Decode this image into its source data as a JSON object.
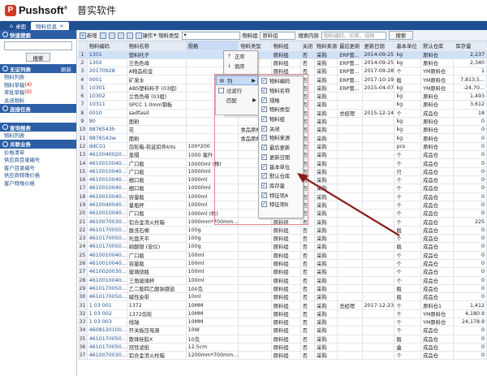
{
  "app": {
    "brand": "Pushsoft",
    "brand_cn": "普实软件",
    "reg": "®"
  },
  "tabs": [
    {
      "label": "桌面"
    },
    {
      "label": "物料信息"
    }
  ],
  "sidebar": {
    "search_header": "快速搜索",
    "search_button": "搜索",
    "filter_header": "无证列表",
    "filter_action": "刷新",
    "filter_items": [
      {
        "label": "物料列表",
        "count": ""
      },
      {
        "label": "物料草稿",
        "count": "(4)"
      },
      {
        "label": "草批草稿",
        "count": "(0)"
      },
      {
        "label": "关闭物料",
        "count": ""
      }
    ],
    "link_header": "连接任务",
    "query_header": "查询报表",
    "query_items": [
      {
        "label": "物料列表"
      }
    ],
    "rel_header": "关联业务",
    "rel_items": [
      {
        "label": "价格清单"
      },
      {
        "label": "供应商目录编号"
      },
      {
        "label": "客户目录编号"
      },
      {
        "label": "供应商特殊价格"
      },
      {
        "label": "客户特殊价格"
      }
    ]
  },
  "toolbar": {
    "new_label": "新增",
    "ops_label": "操作",
    "type_label": "物料类型",
    "group_label": "物料组",
    "group_value": "原料组",
    "content_label": "搜索内容",
    "content_placeholder": "物料编码、名称、规格",
    "search_button": "搜索"
  },
  "table": {
    "columns": [
      "物料编码",
      "物料名称",
      "规格",
      "物料类型",
      "物料组",
      "关闭",
      "物料来源",
      "最后更新",
      "更新日期",
      "基本单位",
      "默认仓库",
      "库存量"
    ],
    "rows": [
      {
        "n": "1",
        "c": "1301",
        "name": "塑料托子",
        "spec": "",
        "type": "",
        "grp": "原料组",
        "close": "否",
        "src": "采购",
        "upd": "ERP管...",
        "date": "2014-09-25",
        "unit": "kg",
        "wh": "原料仓",
        "qty": "2,237"
      },
      {
        "n": "2",
        "c": "1302",
        "name": "兰色色母",
        "spec": "",
        "type": "",
        "grp": "原料组",
        "close": "否",
        "src": "采购",
        "upd": "ERP管...",
        "date": "2014-09-25",
        "unit": "kg",
        "wh": "原料仓",
        "qty": "2,340"
      },
      {
        "n": "3",
        "c": "20170928",
        "name": "A物品校金",
        "spec": "",
        "type": "",
        "grp": "原料组",
        "close": "否",
        "src": "采购",
        "upd": "ERP管...",
        "date": "2017-09-28",
        "unit": "个",
        "wh": "YM原料仓",
        "qty": "1"
      },
      {
        "n": "4",
        "c": "0001",
        "name": "矿泉水",
        "spec": "",
        "type": "",
        "grp": "原料组",
        "close": "否",
        "src": "采购",
        "upd": "ERP管...",
        "date": "2017-10-19",
        "unit": "瓶",
        "wh": "YM原料仓",
        "qty": "7,813,5..."
      },
      {
        "n": "5",
        "c": "10301",
        "name": "ABS塑料料子 (03组)",
        "spec": "",
        "type": "",
        "grp": "原料组",
        "close": "否",
        "src": "采购",
        "upd": "ERP管...",
        "date": "2015-04-07",
        "unit": "kg",
        "wh": "YM原料仓",
        "qty": "-24,70..."
      },
      {
        "n": "6",
        "c": "10302",
        "name": "兰色色母 (03组)",
        "spec": "",
        "type": "",
        "grp": "原料组",
        "close": "否",
        "src": "采购",
        "upd": "",
        "date": "",
        "unit": "kg",
        "wh": "原料仓",
        "qty": "1,493"
      },
      {
        "n": "7",
        "c": "10311",
        "name": "SPCC 1.0mm钢板",
        "spec": "",
        "type": "",
        "grp": "原料组",
        "close": "否",
        "src": "采购",
        "upd": "",
        "date": "",
        "unit": "kg",
        "wh": "原料仓",
        "qty": "3,612"
      },
      {
        "n": "8",
        "c": "0010",
        "name": "sadfasd",
        "spec": "",
        "type": "",
        "grp": "原料组",
        "close": "否",
        "src": "采购",
        "upd": "总经理",
        "date": "2015-12-14",
        "unit": "个",
        "wh": "成品仓",
        "qty": "18"
      },
      {
        "n": "9",
        "c": "90",
        "name": "面粉",
        "spec": "",
        "type": "",
        "grp": "原料组",
        "close": "否",
        "src": "采购",
        "upd": "",
        "date": "",
        "unit": "kg",
        "wh": "原料仓",
        "qty": "0"
      },
      {
        "n": "10",
        "c": "9876543h",
        "name": "花",
        "spec": "",
        "type": "食品原材料",
        "grp": "原料组",
        "close": "否",
        "src": "采购",
        "upd": "",
        "date": "",
        "unit": "kg",
        "wh": "原料仓",
        "qty": "0"
      },
      {
        "n": "11",
        "c": "9876543w",
        "name": "面粉",
        "spec": "",
        "type": "食品原材料",
        "grp": "原料组",
        "close": "否",
        "src": "采购",
        "upd": "",
        "date": "",
        "unit": "kg",
        "wh": "原料仓",
        "qty": "0"
      },
      {
        "n": "12",
        "c": "ddC01",
        "name": "齿轮箱-轮延扣件kits",
        "spec": "100*200",
        "type": "",
        "grp": "原料组",
        "close": "否",
        "src": "采购",
        "upd": "",
        "date": "",
        "unit": "pcs",
        "wh": "原料仓",
        "qty": "0"
      },
      {
        "n": "13",
        "c": "4610040020...",
        "name": "盖帽",
        "spec": "1000 毫升",
        "type": "",
        "grp": "原料组",
        "close": "否",
        "src": "采购",
        "upd": "",
        "date": "",
        "unit": "个",
        "wh": "成品仓",
        "qty": "0"
      },
      {
        "n": "14",
        "c": "4610010040...",
        "name": "广口瓶",
        "spec": "10000ml (株)",
        "type": "",
        "grp": "原料组",
        "close": "否",
        "src": "采购",
        "upd": "",
        "date": "",
        "unit": "个",
        "wh": "成品仓",
        "qty": "0"
      },
      {
        "n": "15",
        "c": "4610010040...",
        "name": "广口瓶",
        "spec": "10000ml",
        "type": "",
        "grp": "原料组",
        "close": "否",
        "src": "采购",
        "upd": "",
        "date": "",
        "unit": "只",
        "wh": "成品仓",
        "qty": "0"
      },
      {
        "n": "16",
        "c": "4610010040...",
        "name": "细口瓶",
        "spec": "1000ml",
        "type": "",
        "grp": "原料组",
        "close": "否",
        "src": "采购",
        "upd": "",
        "date": "",
        "unit": "个",
        "wh": "成品仓",
        "qty": "0"
      },
      {
        "n": "17",
        "c": "4610010040...",
        "name": "细口瓶",
        "spec": "10000ml",
        "type": "",
        "grp": "原料组",
        "close": "否",
        "src": "采购",
        "upd": "",
        "date": "",
        "unit": "个",
        "wh": "成品仓",
        "qty": "0"
      },
      {
        "n": "18",
        "c": "4610010040...",
        "name": "容量瓶",
        "spec": "1000ml",
        "type": "",
        "grp": "原料组",
        "close": "否",
        "src": "采购",
        "upd": "",
        "date": "",
        "unit": "个",
        "wh": "成品仓",
        "qty": "0"
      },
      {
        "n": "19",
        "c": "4610040040...",
        "name": "量瓶杯",
        "spec": "1000ml",
        "type": "",
        "grp": "原料组",
        "close": "否",
        "src": "采购",
        "upd": "",
        "date": "",
        "unit": "个",
        "wh": "成品仓",
        "qty": "0"
      },
      {
        "n": "20",
        "c": "4610010040...",
        "name": "广口瓶",
        "spec": "1000ml (株)",
        "type": "",
        "grp": "原料组",
        "close": "否",
        "src": "采购",
        "upd": "",
        "date": "",
        "unit": "个",
        "wh": "成品仓",
        "qty": "0"
      },
      {
        "n": "21",
        "c": "4610070030...",
        "name": "铝合金消火栓箱",
        "spec": "1000mm*700mm...",
        "type": "",
        "grp": "原料组",
        "close": "否",
        "src": "采购",
        "upd": "",
        "date": "",
        "unit": "个",
        "wh": "成品仓",
        "qty": "225"
      },
      {
        "n": "22",
        "c": "4610170050...",
        "name": "酸洗石棉",
        "spec": "100g",
        "type": "",
        "grp": "原料组",
        "close": "否",
        "src": "采购",
        "upd": "",
        "date": "",
        "unit": "瓶",
        "wh": "成品仓",
        "qty": "0"
      },
      {
        "n": "23",
        "c": "4610170050...",
        "name": "托盘天平",
        "spec": "100g",
        "type": "",
        "grp": "原料组",
        "close": "否",
        "src": "采购",
        "upd": "",
        "date": "",
        "unit": "个",
        "wh": "成品仓",
        "qty": "0"
      },
      {
        "n": "24",
        "c": "4610170050...",
        "name": "硝酸银 (安仪)",
        "spec": "100g",
        "type": "",
        "grp": "原料组",
        "close": "否",
        "src": "采购",
        "upd": "",
        "date": "",
        "unit": "瓶",
        "wh": "成品仓",
        "qty": "0"
      },
      {
        "n": "25",
        "c": "4610010040...",
        "name": "广口瓶",
        "spec": "100ml",
        "type": "",
        "grp": "原料组",
        "close": "否",
        "src": "采购",
        "upd": "",
        "date": "",
        "unit": "个",
        "wh": "成品仓",
        "qty": "0"
      },
      {
        "n": "26",
        "c": "4610010040...",
        "name": "容量瓶",
        "spec": "100ml",
        "type": "",
        "grp": "原料组",
        "close": "否",
        "src": "采购",
        "upd": "",
        "date": "",
        "unit": "个",
        "wh": "成品仓",
        "qty": "0"
      },
      {
        "n": "27",
        "c": "4610020030...",
        "name": "玻璃烧瓶",
        "spec": "100ml",
        "type": "",
        "grp": "原料组",
        "close": "否",
        "src": "采购",
        "upd": "",
        "date": "",
        "unit": "个",
        "wh": "成品仓",
        "qty": "0"
      },
      {
        "n": "28",
        "c": "4610010040...",
        "name": "三角玻璃杯",
        "spec": "100ml",
        "type": "",
        "grp": "原料组",
        "close": "否",
        "src": "采购",
        "upd": "",
        "date": "",
        "unit": "个",
        "wh": "成品仓",
        "qty": "0"
      },
      {
        "n": "29",
        "c": "4610170050...",
        "name": "乙二胺四乙酸钠镁盐",
        "spec": "100克",
        "type": "",
        "grp": "原料组",
        "close": "否",
        "src": "采购",
        "upd": "",
        "date": "",
        "unit": "瓶",
        "wh": "成品仓",
        "qty": "0"
      },
      {
        "n": "30",
        "c": "4610170050...",
        "name": "碱性染带",
        "spec": "10ml",
        "type": "",
        "grp": "原料组",
        "close": "否",
        "src": "采购",
        "upd": "",
        "date": "",
        "unit": "瓶",
        "wh": "成品仓",
        "qty": "0"
      },
      {
        "n": "31",
        "c": "1 03 001",
        "name": "1372",
        "spec": "10MM",
        "type": "",
        "grp": "原料组",
        "close": "否",
        "src": "采购",
        "upd": "总经理",
        "date": "2017-12-23",
        "unit": "个",
        "wh": "原料仓1",
        "qty": "1,412"
      },
      {
        "n": "32",
        "c": "1 03 002",
        "name": "1372齿轮",
        "spec": "10MM",
        "type": "",
        "grp": "原料组",
        "close": "否",
        "src": "采购",
        "upd": "",
        "date": "",
        "unit": "个",
        "wh": "YM原料仓",
        "qty": "4,180.9"
      },
      {
        "n": "33",
        "c": "1 03 003",
        "name": "线轴",
        "spec": "10MM",
        "type": "",
        "grp": "原料组",
        "close": "否",
        "src": "采购",
        "upd": "",
        "date": "",
        "unit": "个",
        "wh": "YM原料仓",
        "qty": "24,178.9"
      },
      {
        "n": "34",
        "c": "4608120100...",
        "name": "开关板压电源",
        "spec": "10W",
        "type": "",
        "grp": "原料组",
        "close": "否",
        "src": "采购",
        "upd": "",
        "date": "",
        "unit": "个",
        "wh": "成品仓",
        "qty": "0"
      },
      {
        "n": "35",
        "c": "4610170050...",
        "name": "散珠硅胶X",
        "spec": "10克",
        "type": "",
        "grp": "原料组",
        "close": "否",
        "src": "采购",
        "upd": "",
        "date": "",
        "unit": "瓶",
        "wh": "成品仓",
        "qty": "0"
      },
      {
        "n": "36",
        "c": "4610170050...",
        "name": "冠性滤纸",
        "spec": "12.5cm",
        "type": "",
        "grp": "原料组",
        "close": "否",
        "src": "采购",
        "upd": "",
        "date": "",
        "unit": "盒",
        "wh": "成品仓",
        "qty": "0"
      },
      {
        "n": "37",
        "c": "4610070030...",
        "name": "铝合金消火栓箱",
        "spec": "1200mm*700mm...",
        "type": "",
        "grp": "原料组",
        "close": "否",
        "src": "采购",
        "upd": "",
        "date": "",
        "unit": "个",
        "wh": "成品仓",
        "qty": "0"
      }
    ]
  },
  "sort_menu": [
    {
      "icon": "↑",
      "label": "正序"
    },
    {
      "icon": "↓",
      "label": "倒序"
    }
  ],
  "col_menu": [
    {
      "label": "列",
      "arrow": "▶"
    },
    {
      "label": "过滤行"
    },
    {
      "label": "匹配",
      "arrow": "▶"
    }
  ],
  "col_options": [
    {
      "label": "物料编码",
      "checked": true
    },
    {
      "label": "物料名称",
      "checked": true
    },
    {
      "label": "规格",
      "checked": true
    },
    {
      "label": "物料类型",
      "checked": true
    },
    {
      "label": "物料组",
      "checked": true
    },
    {
      "label": "关闭",
      "checked": true
    },
    {
      "label": "物料来源",
      "checked": true
    },
    {
      "label": "最后更新",
      "checked": true
    },
    {
      "label": "更新日期",
      "checked": true
    },
    {
      "label": "基本单位",
      "checked": true
    },
    {
      "label": "默认仓库",
      "checked": true
    },
    {
      "label": "库存量",
      "checked": true
    },
    {
      "label": "特征项A",
      "checked": true
    },
    {
      "label": "特征项B",
      "checked": true
    }
  ]
}
